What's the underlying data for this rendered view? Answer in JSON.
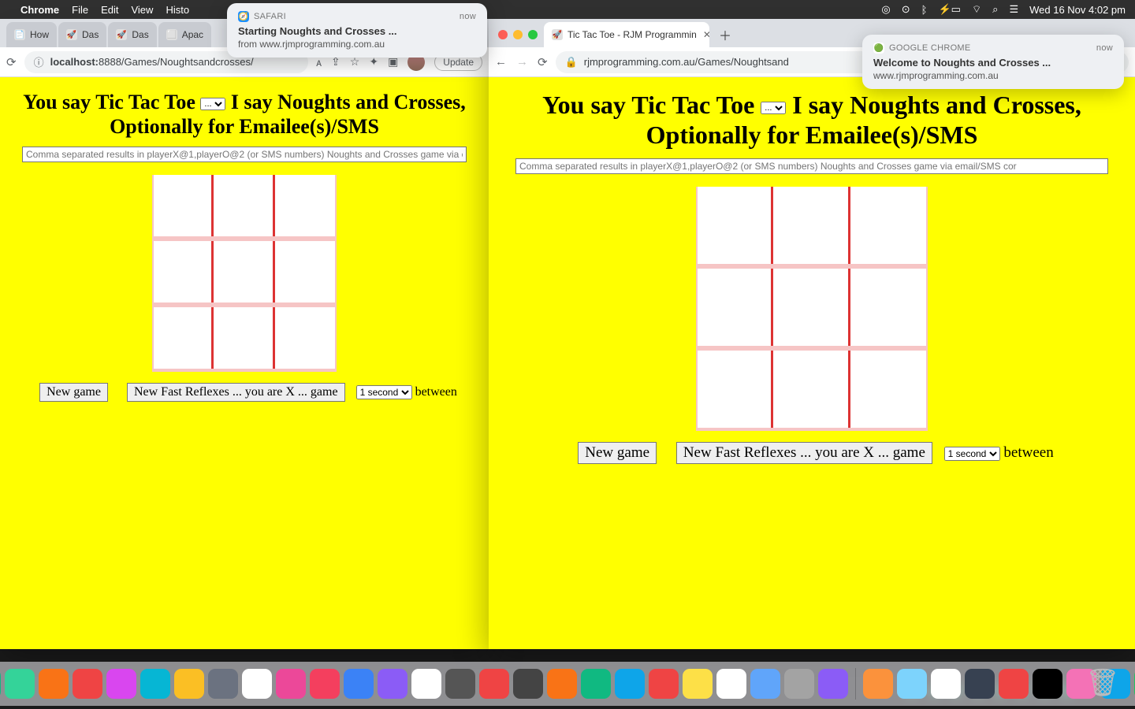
{
  "menubar": {
    "app": "Chrome",
    "items": [
      "File",
      "Edit",
      "View",
      "Histo"
    ],
    "clock": "Wed 16 Nov  4:02 pm"
  },
  "notif_safari": {
    "app": "SAFARI",
    "time": "now",
    "title": "Starting Noughts and Crosses ...",
    "sub": "from www.rjmprogramming.com.au"
  },
  "notif_chrome": {
    "app": "GOOGLE CHROME",
    "time": "now",
    "title": "Welcome to Noughts and Crosses ...",
    "sub": "www.rjmprogramming.com.au"
  },
  "left_window": {
    "tabs": [
      "How",
      "Das",
      "Das",
      "Apac"
    ],
    "url_prefix": "localhost:",
    "url_rest": "8888/Games/Noughtsandcrosses/",
    "update": "Update"
  },
  "right_window": {
    "tab_title": "Tic Tac Toe - RJM Programmin",
    "url": "rjmprogramming.com.au/Games/Noughtsand"
  },
  "page": {
    "h1a": "You say Tic Tac Toe",
    "h1b": "I say Noughts and Crosses, Optionally for Emailee(s)/SMS",
    "select_placeholder": "...",
    "email_placeholder": "Comma separated results in playerX@1,playerO@2 (or SMS numbers) Noughts and Crosses game via email/SMS cor",
    "newgame": "New game",
    "fast": "New Fast Reflexes ... you are X ... game",
    "sec": "1 second",
    "between": "between"
  },
  "dock": {
    "count": 39
  }
}
